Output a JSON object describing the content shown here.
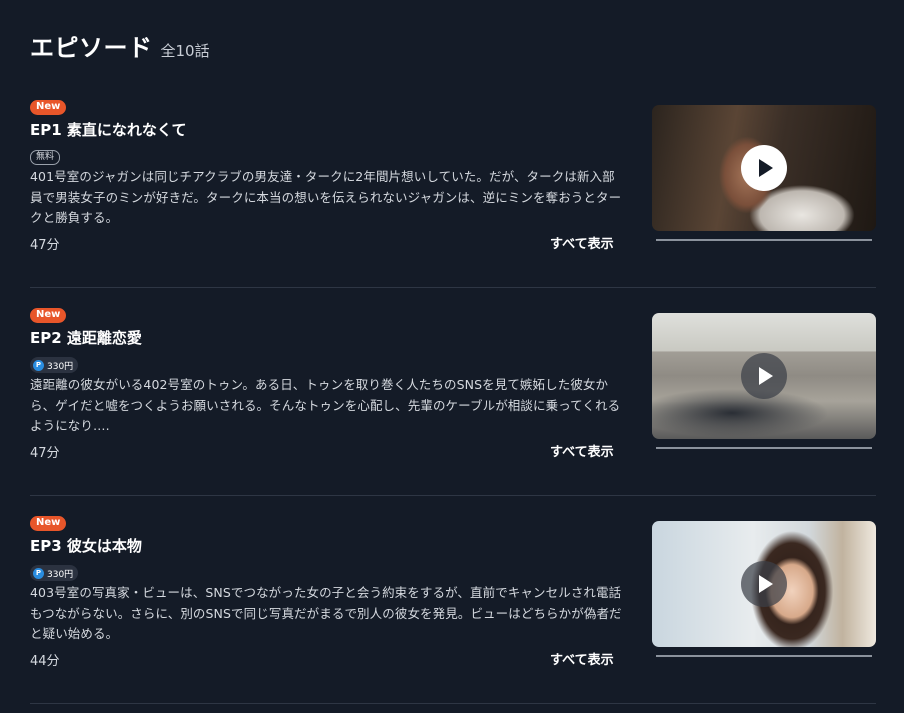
{
  "header": {
    "title": "エピソード",
    "count": "全10話"
  },
  "episodes": [
    {
      "badge": "New",
      "title": "EP1 素直になれなくて",
      "price_type": "free",
      "price_label": "無料",
      "description": "401号室のジャガンは同じチアクラブの男友達・タークに2年間片想いしていた。だが、タークは新入部員で男装女子のミンが好きだ。タークに本当の想いを伝えられないジャガンは、逆にミンを奪おうとタークと勝負する。",
      "duration": "47分",
      "show_all": "すべて表示"
    },
    {
      "badge": "New",
      "title": "EP2 遠距離恋愛",
      "price_type": "paid",
      "price_icon": "P",
      "price_label": "330円",
      "description": "遠距離の彼女がいる402号室のトゥン。ある日、トゥンを取り巻く人たちのSNSを見て嫉妬した彼女から、ゲイだと嘘をつくようお願いされる。そんなトゥンを心配し、先輩のケーブルが相談に乗ってくれるようになり….",
      "duration": "47分",
      "show_all": "すべて表示"
    },
    {
      "badge": "New",
      "title": "EP3 彼女は本物",
      "price_type": "paid",
      "price_icon": "P",
      "price_label": "330円",
      "description": "403号室の写真家・ビューは、SNSでつながった女の子と会う約束をするが、直前でキャンセルされ電話もつながらない。さらに、別のSNSで同じ写真だがまるで別人の彼女を発見。ビューはどちらかが偽者だと疑い始める。",
      "duration": "44分",
      "show_all": "すべて表示"
    }
  ],
  "colors": {
    "background": "#141b27",
    "new_badge": "#e8562a",
    "point_icon": "#2a8de0"
  },
  "icons": {
    "play": "play-icon",
    "point": "point-coin-icon"
  }
}
